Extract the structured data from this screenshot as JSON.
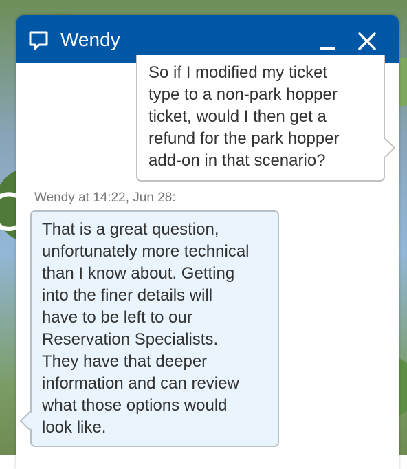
{
  "header": {
    "title": "Wendy",
    "chat_icon": "speech-bubble-icon",
    "minimize_icon": "minimize-icon",
    "close_icon": "close-icon",
    "background_color": "#0057a6"
  },
  "background": {
    "partial_glyph": "C"
  },
  "messages": {
    "user_message": "So if I modified my ticket\ntype to a non-park hopper\nticket, would I then get a\nrefund for the park hopper\nadd-on in that scenario?",
    "agent_sender_label": "Wendy at 14:22, Jun 28:",
    "agent_message": "That is a great question,\nunfortunately more technical\nthan I know about. Getting\ninto the finer details will\nhave to be left to our\nReservation Specialists.\nThey have that deeper\ninformation and can review\nwhat those options would\nlook like.",
    "agent_bubble_color": "#e9f4fd"
  }
}
